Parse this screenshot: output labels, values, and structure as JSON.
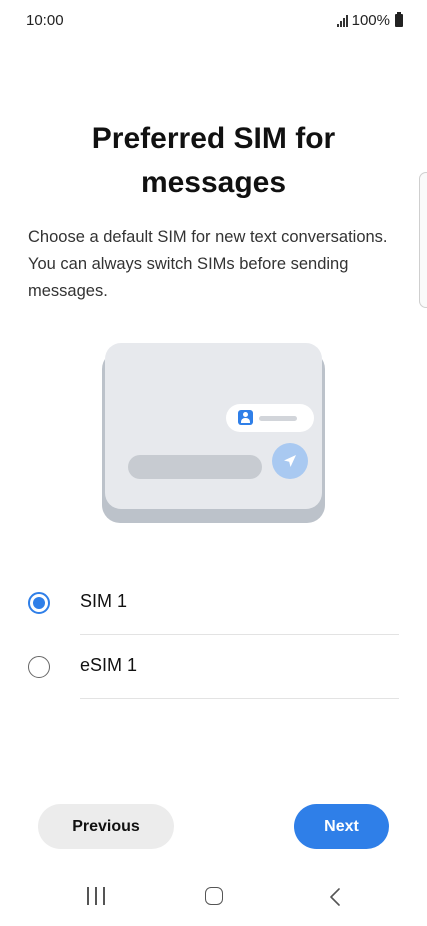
{
  "status_bar": {
    "time": "10:00",
    "battery": "100%"
  },
  "title": "Preferred SIM for messages",
  "description": "Choose a default SIM for new text conversations. You can always switch SIMs before sending messages.",
  "options": [
    {
      "label": "SIM 1",
      "selected": true
    },
    {
      "label": "eSIM 1",
      "selected": false
    }
  ],
  "buttons": {
    "previous": "Previous",
    "next": "Next"
  },
  "colors": {
    "accent": "#2f7fe8",
    "illustration_send": "#a9c9f1"
  },
  "icons": {
    "signal": "signal-bars-icon",
    "battery": "battery-icon",
    "contact": "contact-icon",
    "send": "send-icon",
    "recents": "recents-icon",
    "home": "home-icon",
    "back": "back-icon"
  }
}
